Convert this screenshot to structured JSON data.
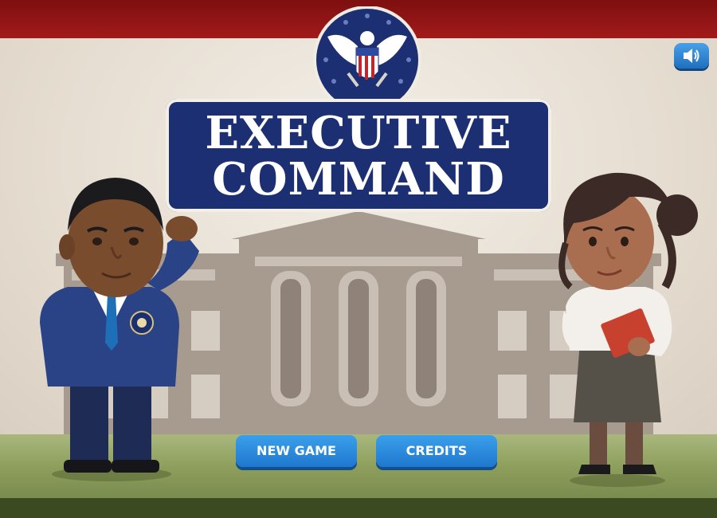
{
  "game": {
    "title_line1": "EXECUTIVE",
    "title_line2": "COMMAND"
  },
  "menu": {
    "new_game_label": "NEW GAME",
    "credits_label": "CREDITS"
  },
  "icons": {
    "sound": "speaker-volume-icon",
    "seal": "presidential-eagle-seal"
  },
  "colors": {
    "banner_red": "#a21a1a",
    "title_navy": "#1b2f72",
    "button_blue": "#2a8ae0"
  }
}
